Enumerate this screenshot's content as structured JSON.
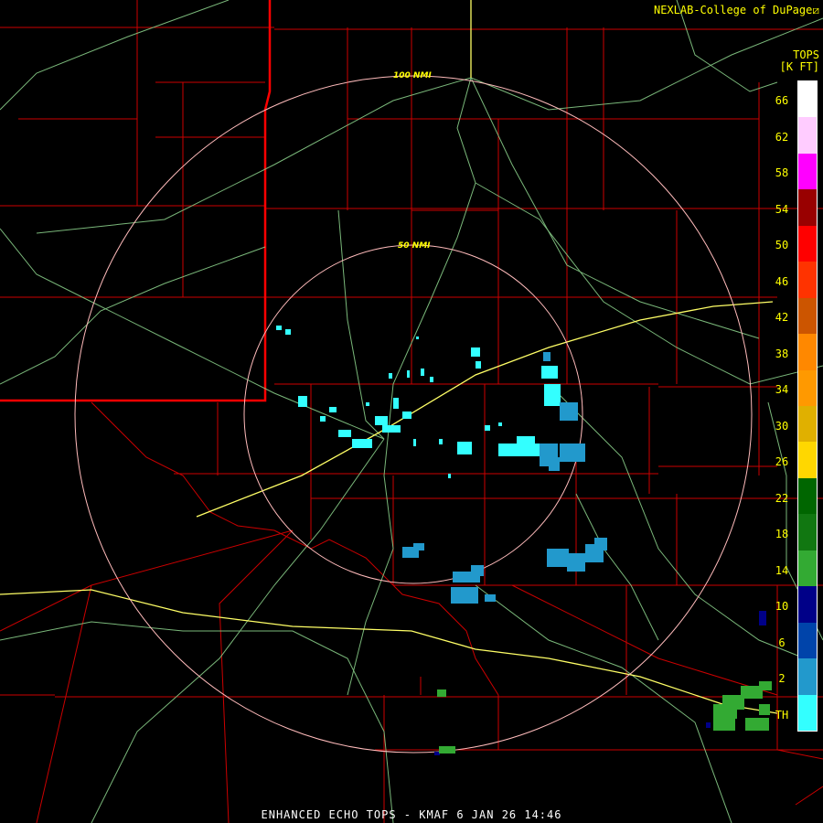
{
  "credit": "NEXLAB-College of DuPage",
  "credit_mark": "⧄",
  "legend": {
    "title_line1": "TOPS",
    "title_line2": "[K FT]",
    "labels": [
      "66",
      "62",
      "58",
      "54",
      "50",
      "46",
      "42",
      "38",
      "34",
      "30",
      "26",
      "22",
      "18",
      "14",
      "10",
      "6",
      "2",
      "TH"
    ],
    "colors": [
      "#ffffff",
      "#ffccff",
      "#ff00ff",
      "#990000",
      "#ff0000",
      "#ff3300",
      "#cc5500",
      "#ff8800",
      "#ff9900",
      "#e0b000",
      "#ffd700",
      "#006600",
      "#117711",
      "#33aa33",
      "#000088",
      "#0044aa",
      "#2299cc",
      "#33ffff"
    ]
  },
  "rings": {
    "outer_label": "100 NMI",
    "inner_label": "50 NMI"
  },
  "footer": "ENHANCED ECHO TOPS - KMAF 6 JAN 26 14:46",
  "colors": {
    "background": "#000000",
    "county_lines": "#cc0000",
    "state_line": "#ff0000",
    "roads": "#88cc88",
    "interstate": "#ffff66",
    "range_rings": "#ffbbbb",
    "text": "#ffff00"
  }
}
